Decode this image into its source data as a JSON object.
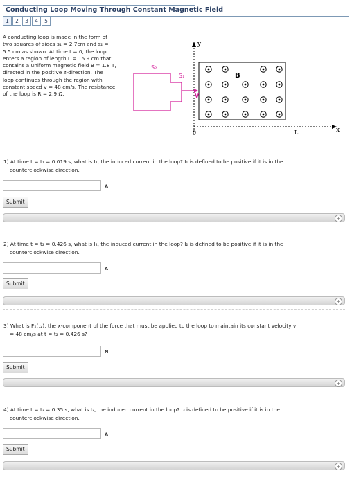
{
  "header": {
    "title": "Conducting Loop Moving Through Constant Magnetic Field",
    "tabs": [
      "1",
      "2",
      "3",
      "4",
      "5"
    ]
  },
  "intro_lines": [
    "A conducting loop is made in the form of",
    "two squares of sides s₁ = 2.7cm and s₂ =",
    "5.5 cm as shown. At time t = 0, the loop",
    "enters a region of length L = 15.9 cm that",
    "contains a uniform magnetic field B = 1.8 T,",
    "directed in the positive z-direction. The",
    "loop continues through the region with",
    "constant speed v = 48 cm/s. The resistance",
    "of the loop is R = 2.9 Ω."
  ],
  "figure": {
    "s2_label": "S₂",
    "s1_label": "S₁",
    "v_label": "V",
    "b_label": "B",
    "y_label": "y",
    "x_label": "x",
    "origin_label": "0",
    "l_label": "L",
    "colors": {
      "loop": "#d4209a",
      "box": "#000000"
    }
  },
  "questions": [
    {
      "line1": "1) At time t = t₁ = 0.019 s, what is I₁, the induced current in the loop? I₁ is defined to be positive if it is in the",
      "line2": "counterclockwise direction.",
      "unit": "A",
      "submit": "Submit"
    },
    {
      "line1": "2) At time t = t₂ = 0.426 s, what is I₂, the induced current in the loop? I₂ is defined to be positive if it is in the",
      "line2": "counterclockwise direction.",
      "unit": "A",
      "submit": "Submit"
    },
    {
      "line1": "3) What is Fₓ(t₂), the x-component of the force that must be applied to the loop to maintain its constant velocity v",
      "line2": "= 48 cm/s at t = t₂ = 0.426 s?",
      "unit": "N",
      "submit": "Submit"
    },
    {
      "line1": "4) At time t = t₃ = 0.35 s, what is I₃, the induced current in the loop? I₃ is defined to be positive if it is in the",
      "line2": "counterclockwise direction.",
      "unit": "A",
      "submit": "Submit"
    }
  ]
}
